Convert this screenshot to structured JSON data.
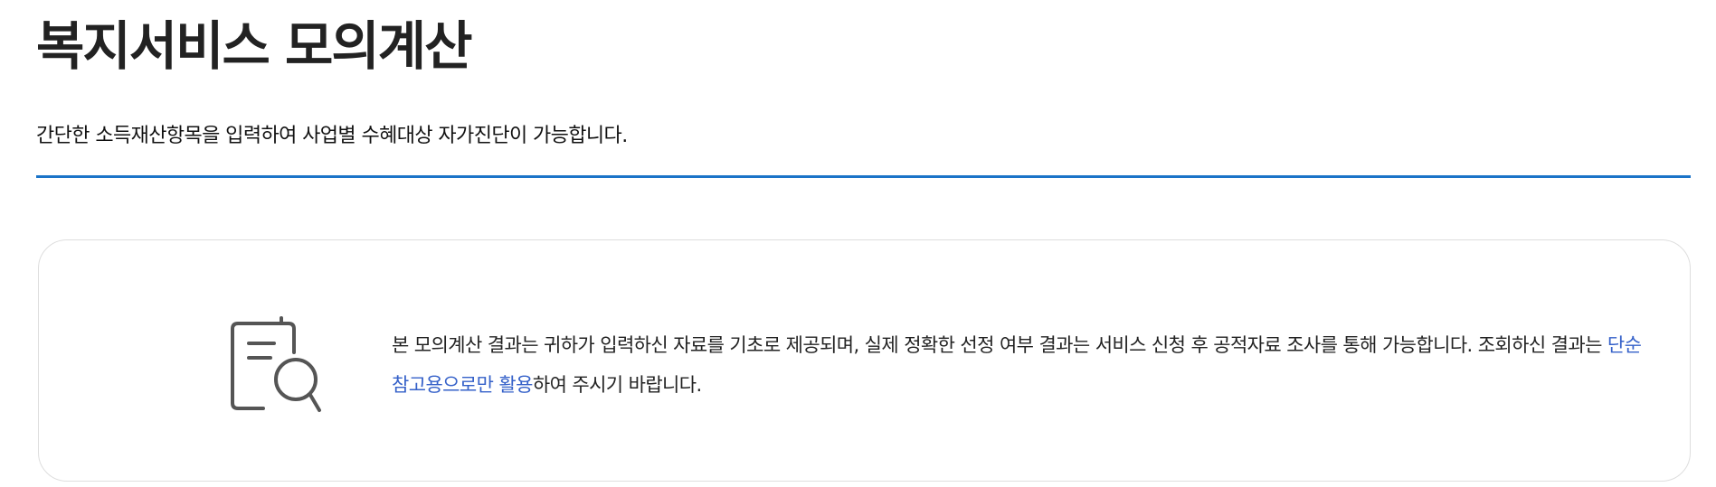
{
  "header": {
    "title": "복지서비스 모의계산",
    "subtitle": "간단한 소득재산항목을 입력하여 사업별 수혜대상 자가진단이 가능합니다."
  },
  "notice": {
    "icon": "document-search-icon",
    "text_part1": "본 모의계산 결과는 귀하가 입력하신 자료를 기초로 제공되며, 실제 정확한 선정 여부 결과는 서비스 신청 후 공적자료 조사를 통해 가능합니다. 조회하신 결과는 ",
    "text_highlight": "단순 참고용으로만 활용",
    "text_part2": "하여 주시기 바랍니다."
  },
  "colors": {
    "accent": "#1a73c8",
    "highlight_text": "#3561c9",
    "border": "#dedede",
    "icon_stroke": "#555555"
  }
}
